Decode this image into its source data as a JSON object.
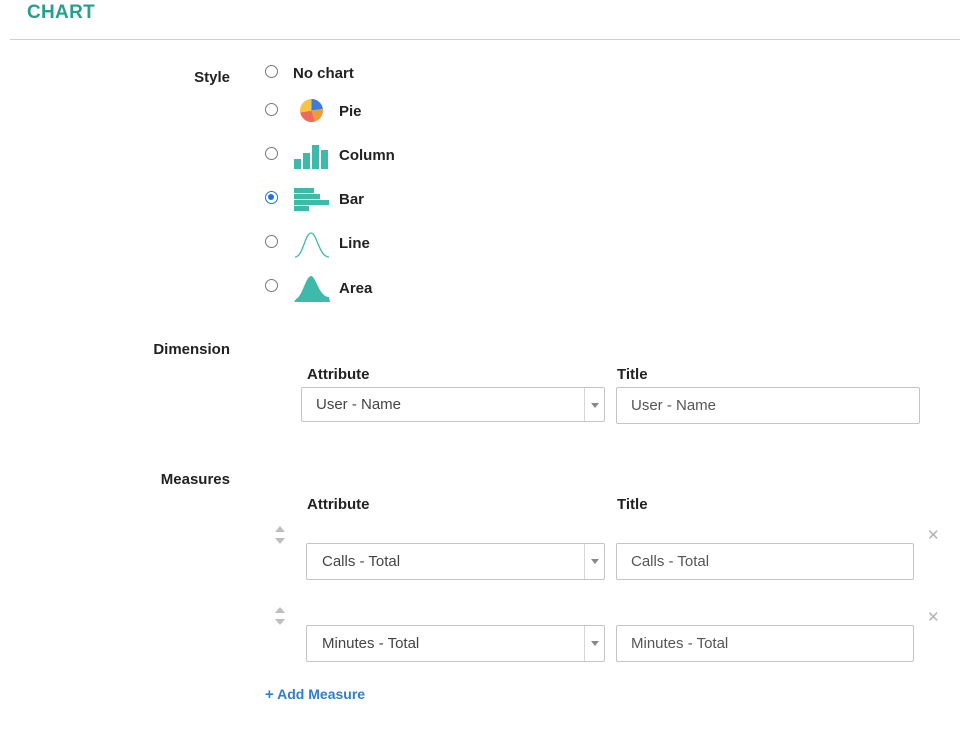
{
  "section": {
    "title": "CHART"
  },
  "style": {
    "label": "Style",
    "options": [
      {
        "label": "No chart",
        "icon": "",
        "checked": false
      },
      {
        "label": "Pie",
        "icon": "pie-chart-icon",
        "checked": false
      },
      {
        "label": "Column",
        "icon": "column-chart-icon",
        "checked": false
      },
      {
        "label": "Bar",
        "icon": "bar-chart-icon",
        "checked": true
      },
      {
        "label": "Line",
        "icon": "line-chart-icon",
        "checked": false
      },
      {
        "label": "Area",
        "icon": "area-chart-icon",
        "checked": false
      }
    ]
  },
  "dimension": {
    "label": "Dimension",
    "attribute_header": "Attribute",
    "title_header": "Title",
    "attribute_value": "User - Name",
    "title_value": "User - Name"
  },
  "measures": {
    "label": "Measures",
    "attribute_header": "Attribute",
    "title_header": "Title",
    "rows": [
      {
        "attribute_value": "Calls - Total",
        "title_value": "Calls - Total"
      },
      {
        "attribute_value": "Minutes - Total",
        "title_value": "Minutes - Total"
      }
    ],
    "add_label": "Add Measure",
    "add_icon": "plus-icon",
    "remove_icon": "close-icon",
    "drag_icon": "sort-handle-icon"
  },
  "colors": {
    "accent": "#25a08a",
    "chart_teal": "#3dbaa9",
    "link": "#2b7fd1",
    "radio_selected": "#1a73e8",
    "pie_orange": "#f29a3a",
    "pie_blue": "#3b7dd8",
    "pie_red": "#ec6a5e",
    "pie_yellow": "#f6c445"
  }
}
